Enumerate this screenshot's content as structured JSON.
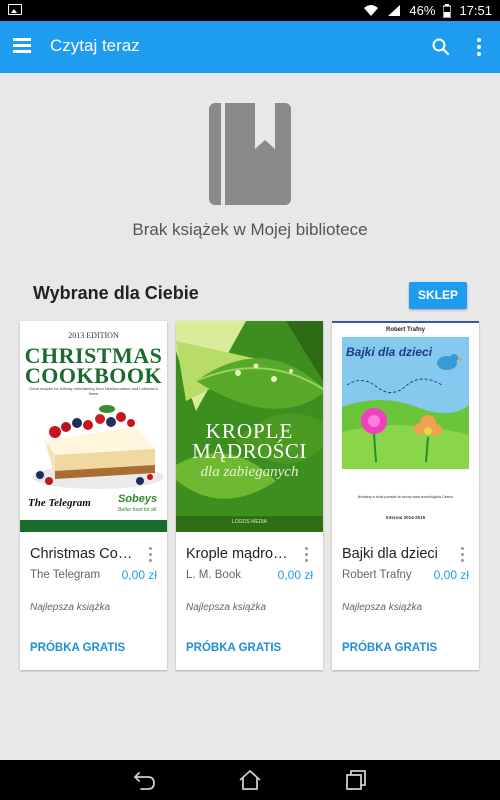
{
  "status_bar": {
    "battery": "46%",
    "time": "17:51"
  },
  "app_bar": {
    "title": "Czytaj teraz"
  },
  "library": {
    "empty_message": "Brak książek w Mojej bibliotece"
  },
  "recommended": {
    "title": "Wybrane dla Ciebie",
    "shop_label": "SKLEP",
    "books": [
      {
        "title": "Christmas Co…",
        "author": "The Telegram",
        "price": "0,00 zł",
        "badge": "Najlepsza książka",
        "sample_label": "PRÓBKA GRATIS",
        "cover": {
          "edition": "2013 EDITION",
          "line1": "CHRISTMAS",
          "line2": "COOKBOOK",
          "tagline": "Great recipes for holiday entertaining from Newfoundland and Labrador's finest",
          "publisher": "The Telegram",
          "sponsor": "Sobeys",
          "sponsor_tag": "Better food for all"
        }
      },
      {
        "title": "Krople mądroś…",
        "author": "L. M. Book",
        "price": "0,00 zł",
        "badge": "Najlepsza książka",
        "sample_label": "PRÓBKA GRATIS",
        "cover": {
          "line1": "KROPLE",
          "line2": "MĄDROŚCI",
          "subtitle": "dla zabieganych",
          "imprint": "LOGOS MEDIA"
        }
      },
      {
        "title": "Bajki dla dzieci",
        "author": "Robert Trafny",
        "price": "0,00 zł",
        "badge": "Najlepsza książka",
        "sample_label": "PRÓBKA GRATIS",
        "cover": {
          "author": "Robert Trafny",
          "title": "Bajki dla dzieci",
          "note": "Niniejszy e-book powstał ze strony www.chomikuj/pila.Czernu",
          "footer": "Internat 2014-2015"
        }
      }
    ]
  },
  "colors": {
    "accent": "#1e9cef",
    "background": "#e8e8e8"
  }
}
